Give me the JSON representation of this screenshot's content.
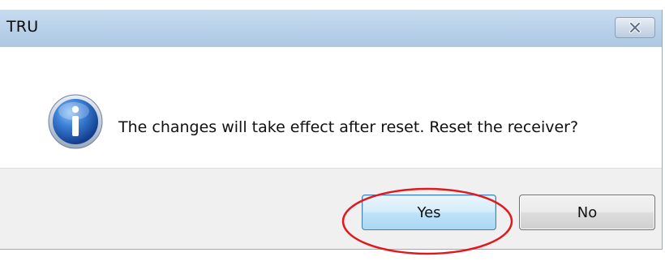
{
  "window": {
    "title": "TRU",
    "close_icon": "close-icon"
  },
  "message": {
    "icon": "info-icon",
    "text": "The changes will take effect after reset. Reset the receiver?"
  },
  "buttons": {
    "yes_label": "Yes",
    "no_label": "No"
  },
  "annotation": {
    "highlight_color": "#e0191f",
    "highlights": "Yes button"
  },
  "colors": {
    "titlebar": "#b9d1ea",
    "button_area": "#f0f0f0",
    "default_button_border": "#3c7fb1"
  }
}
